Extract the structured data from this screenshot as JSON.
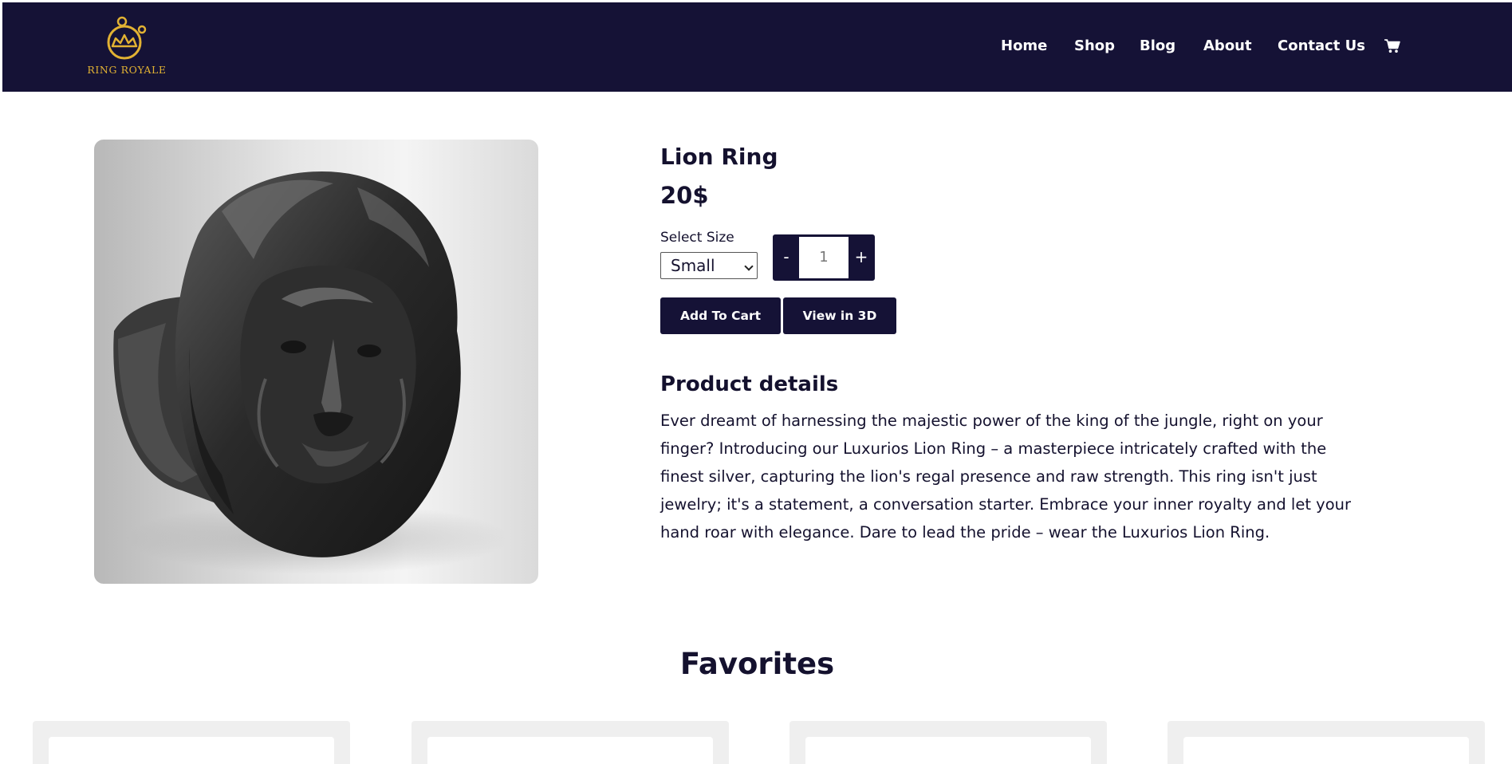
{
  "brand": {
    "name": "RING ROYALE",
    "accent_color": "#e2b233",
    "dark_color": "#151236"
  },
  "nav": {
    "items": [
      "Home",
      "Shop",
      "Blog",
      "About",
      "Contact Us"
    ],
    "cart_icon": "cart-icon"
  },
  "product": {
    "title": "Lion Ring",
    "price": "20$",
    "size_label": "Select Size",
    "size_value": "Small",
    "quantity_minus": "-",
    "quantity_value": "1",
    "quantity_plus": "+",
    "add_to_cart": "Add To Cart",
    "view_3d": "View in 3D",
    "details_heading": "Product details",
    "details_lines": [
      "Ever dreamt of harnessing the majestic power of the king of the jungle, right on your",
      "finger? Introducing our Luxurios Lion Ring – a masterpiece intricately crafted with the",
      "finest silver, capturing the lion's regal presence and raw strength. This ring isn't just",
      "jewelry; it's a statement, a conversation starter. Embrace your inner royalty and let your",
      "hand roar with elegance. Dare to lead the pride – wear the Luxurios Lion Ring."
    ]
  },
  "favorites": {
    "heading": "Favorites",
    "card_count": 4
  }
}
